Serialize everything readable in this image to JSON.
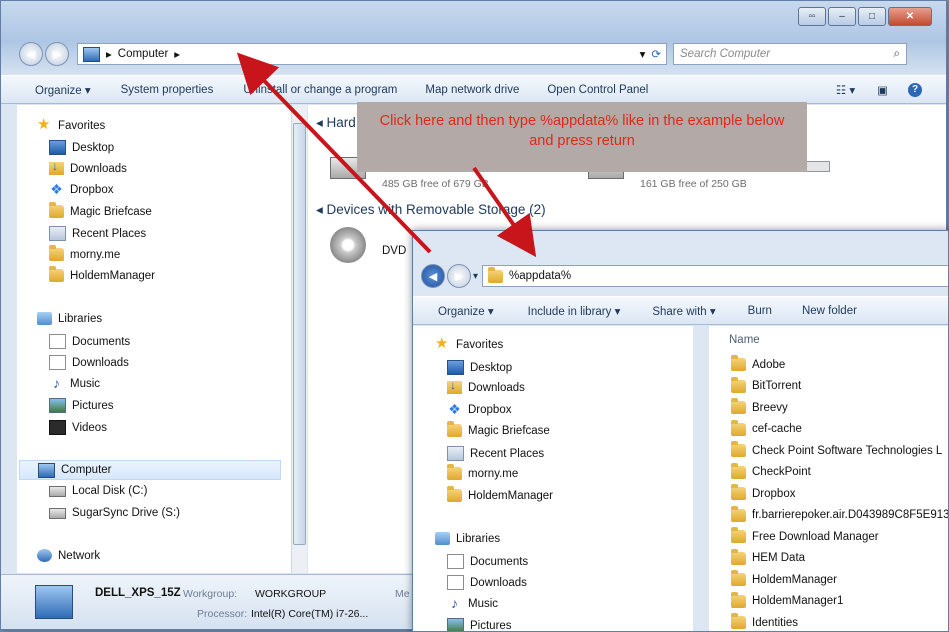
{
  "back_window": {
    "address": {
      "root": "Computer"
    },
    "search_placeholder": "Search Computer",
    "toolbar": [
      "Organize ▾",
      "System properties",
      "Uninstall or change a program",
      "Map network drive",
      "Open Control Panel"
    ],
    "nav": {
      "favorites_label": "Favorites",
      "favorites": [
        "Desktop",
        "Downloads",
        "Dropbox",
        "Magic Briefcase",
        "Recent Places",
        "morny.me",
        "HoldemManager"
      ],
      "libraries_label": "Libraries",
      "libraries": [
        "Documents",
        "Downloads",
        "Music",
        "Pictures",
        "Videos"
      ],
      "computer_label": "Computer",
      "drives": [
        "Local Disk (C:)",
        "SugarSync Drive (S:)"
      ],
      "network_label": "Network"
    },
    "content": {
      "hard_disks_header": "Hard",
      "drive1_free": "485 GB free of 679 GB",
      "drive1_fill": 0.29,
      "drive2_free": "161 GB free of 250 GB",
      "drive2_fill": 0.36,
      "removable_header": "Devices with Removable Storage (2)",
      "dvd_label": "DVD"
    },
    "details": {
      "name": "DELL_XPS_15Z",
      "workgroup_label": "Workgroup:",
      "workgroup_value": "WORKGROUP",
      "processor_label": "Processor:",
      "processor_value": "Intel(R) Core(TM) i7-26...",
      "memory_label": "Me"
    }
  },
  "callout": {
    "text": "Click here and then type %appdata% like in the example below and press return"
  },
  "front_window": {
    "address_value": "%appdata%",
    "toolbar": [
      "Organize ▾",
      "Include in library ▾",
      "Share with ▾",
      "Burn",
      "New folder"
    ],
    "nav": {
      "favorites_label": "Favorites",
      "favorites": [
        "Desktop",
        "Downloads",
        "Dropbox",
        "Magic Briefcase",
        "Recent Places",
        "morny.me",
        "HoldemManager"
      ],
      "libraries_label": "Libraries",
      "libraries": [
        "Documents",
        "Downloads",
        "Music",
        "Pictures"
      ]
    },
    "column_header": "Name",
    "files": [
      "Adobe",
      "BitTorrent",
      "Breevy",
      "cef-cache",
      "Check Point Software Technologies L",
      "CheckPoint",
      "Dropbox",
      "fr.barrierepoker.air.D043989C8F5E913",
      "Free Download Manager",
      "HEM Data",
      "HoldemManager",
      "HoldemManager1",
      "Identities"
    ]
  },
  "colors": {
    "callout_text": "#e0271a",
    "arrow": "#c8151b",
    "callout_bg": "#b3aaa7"
  }
}
